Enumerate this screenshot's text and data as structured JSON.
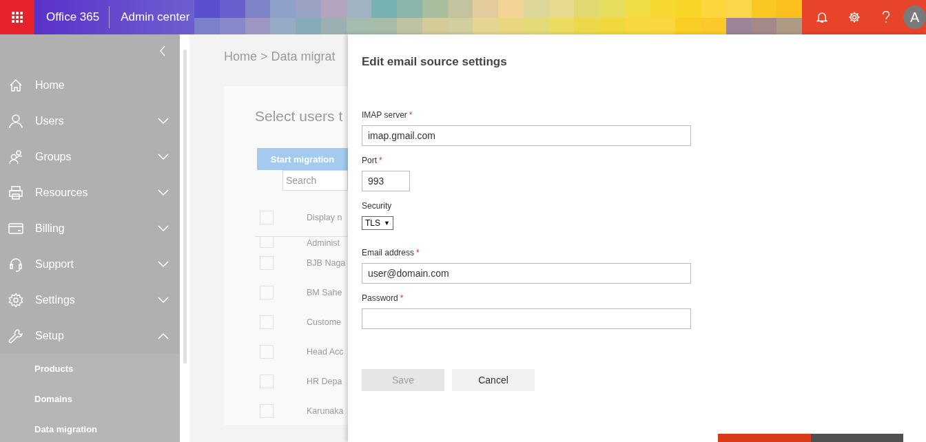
{
  "header": {
    "product": "Office 365",
    "title": "Admin center",
    "avatar": "A"
  },
  "sidebar": {
    "items": [
      {
        "label": "Home"
      },
      {
        "label": "Users",
        "expanded": false
      },
      {
        "label": "Groups",
        "expanded": false
      },
      {
        "label": "Resources",
        "expanded": false
      },
      {
        "label": "Billing",
        "expanded": false
      },
      {
        "label": "Support",
        "expanded": false
      },
      {
        "label": "Settings",
        "expanded": false
      },
      {
        "label": "Setup",
        "expanded": true,
        "children": [
          {
            "label": "Products"
          },
          {
            "label": "Domains"
          },
          {
            "label": "Data migration"
          }
        ]
      }
    ]
  },
  "page": {
    "breadcrumb": "Home > Data migrat",
    "title": "Select users t",
    "start_button": "Start migration",
    "search": {
      "placeholder": "Search"
    },
    "all_checked": false,
    "column_header": "Display n",
    "rows": [
      {
        "name": "Administ",
        "checked": false
      },
      {
        "name": "BJB Naga",
        "checked": false
      },
      {
        "name": "BM Sahe",
        "checked": false
      },
      {
        "name": "Custome",
        "checked": false
      },
      {
        "name": "Head Acc",
        "checked": false
      },
      {
        "name": "HR Depa",
        "checked": false
      },
      {
        "name": "Karunaka",
        "checked": false
      }
    ]
  },
  "panel": {
    "title": "Edit email source settings",
    "fields": [
      {
        "kind": "text",
        "label": "IMAP server",
        "required_mark": "*",
        "value": "imap.gmail.com"
      },
      {
        "kind": "number",
        "label": "Port",
        "required_mark": "*",
        "value": "993"
      },
      {
        "kind": "select",
        "label": "Security",
        "value": "TLS",
        "caret": "▼"
      },
      {
        "kind": "text",
        "label": "Email address",
        "required_mark": "*",
        "value": "user@domain.com"
      },
      {
        "kind": "password",
        "label": "Password",
        "required_mark": "*"
      }
    ],
    "buttons": [
      {
        "label": "Save",
        "disabled": true
      },
      {
        "label": "Cancel",
        "disabled": false
      }
    ]
  }
}
